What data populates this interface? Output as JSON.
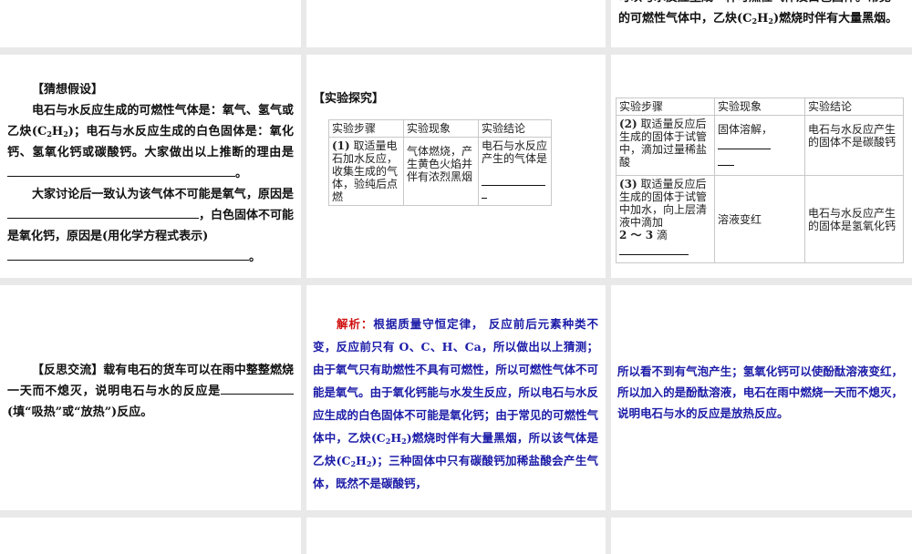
{
  "slides": {
    "top_right": {
      "line_clipped": "可以与水反应生成一种可燃性气体及白色固体。常见",
      "line_a": "的可燃性气体中，乙炔(C",
      "sub1": "2",
      "mid": "H",
      "sub2": "2",
      "line_b": ")燃烧时伴有大量黑烟。"
    },
    "hypothesis": {
      "heading": "【猜想假设】",
      "p1_a": "电石与水反应生成的可燃性气体是：氧气、氢气或乙炔(C",
      "sub1": "2",
      "mid": "H",
      "sub2": "2",
      "p1_b": ")；电石与水反应生成的白色固体是：氧化钙、氢氧化钙或碳酸钙。大家做出以上推断的理由是",
      "p1_end": "。",
      "p2_a": "大家讨论后一致认为该气体不可能是氧气，原因是",
      "p2_b": "，白色固体不可能是氧化钙，原因是(用化学方程式表示)",
      "p2_end": "。"
    },
    "experiment": {
      "heading": "【实验探究】",
      "headers": [
        "实验步骤",
        "实验现象",
        "实验结论"
      ],
      "row1": {
        "num": "(1)",
        "step": " 取适量电石加水反应，收集生成的气体，验纯后点燃",
        "phenomenon": "气体燃烧，产生黄色火焰并伴有浓烈黑烟",
        "conclusion": "电石与水反应产生的气体是"
      }
    },
    "experiment_cont": {
      "headers": [
        "实验步骤",
        "实验现象",
        "实验结论"
      ],
      "row2": {
        "num": "(2)",
        "step": " 取适量反应后生成的固体于试管中，滴加过量稀盐酸",
        "phenomenon": "固体溶解，",
        "conclusion": "电石与水反应产生的固体不是碳酸钙"
      },
      "row3": {
        "num": "(3)",
        "step": " 取适量反应后生成的固体于试管中加水，向上层清液中滴加",
        "drops": "2 ～ 3",
        "drops_unit": " 滴",
        "phenomenon": "溶液变红",
        "conclusion": "电石与水反应产生的固体是氢氧化钙"
      }
    },
    "reflection": {
      "text_a": "【反思交流】载有电石的货车可以在雨中整整燃烧一天而不熄灭，说明电石与水的反应是",
      "text_b": "(填“吸热”或“放热”)反应。"
    },
    "analysis": {
      "label": "解析：",
      "t1": "根据质量守恒定律， 反应前后元素种类不变，反应前只有 O、C、H、Ca，所以做出以上猜测；由于氧气只有助燃性不具有可燃性，所以可燃性气体不可能是氧气。由于氧化钙能与水发生反应，所以电石与水反应生成的白色固体不可能是氧化钙；由于常见的可燃性气体中，乙炔(C",
      "s1": "2",
      "m1": "H",
      "s2": "2",
      "t2": ")燃烧时伴有大量黑烟，所以该气体是乙炔(C",
      "s3": "2",
      "m2": "H",
      "s4": "2",
      "t3": ")；三种固体中只有碳酸钙加稀盐酸会产生气体，既然不是碳酸钙，"
    },
    "analysis_cont": {
      "text": "所以看不到有气泡产生；氢氧化钙可以使酚酞溶液变红，所以加入的是酚酞溶液，电石在雨中燃烧一天而不熄灭，说明电石与水的反应是放热反应。"
    }
  }
}
